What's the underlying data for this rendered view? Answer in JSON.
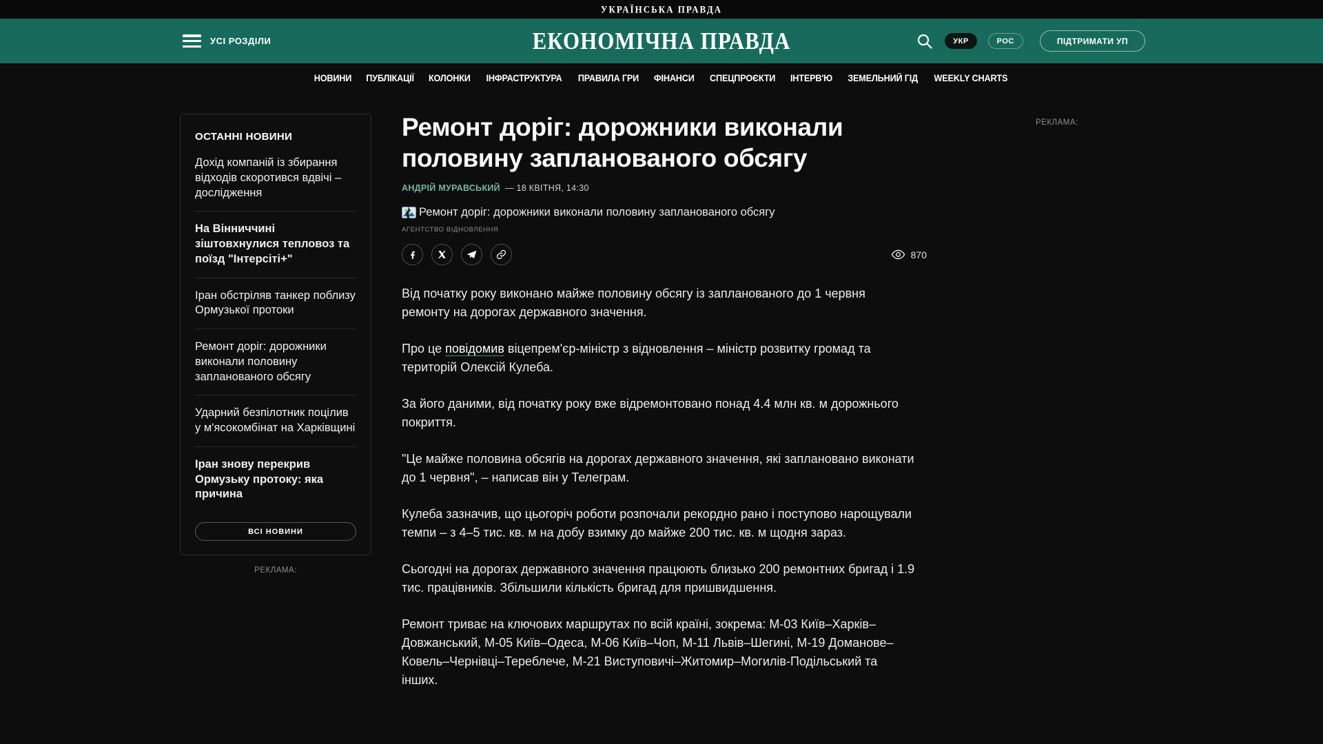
{
  "top_bar": {
    "logo": "УКРАЇНСЬКА ПРАВДА"
  },
  "header": {
    "menu_label": "УСІ РОЗДІЛИ",
    "logo": "ЕКОНОМІЧНА ПРАВДА",
    "lang_active": "УКР",
    "lang_inactive": "РОС",
    "support_button": "ПІДТРИМАТИ УП",
    "accent_color": "#186b5c"
  },
  "nav": {
    "items": [
      "НОВИНИ",
      "ПУБЛІКАЦІЇ",
      "КОЛОНКИ",
      "ІНФРАСТРУКТУРА",
      "ПРАВИЛА ГРИ",
      "ФІНАНСИ",
      "СПЕЦПРОЄКТИ",
      "ІНТЕРВ'Ю",
      "ЗЕМЕЛЬНИЙ ГІД",
      "WEEKLY CHARTS"
    ]
  },
  "sidebar": {
    "title": "ОСТАННІ НОВИНИ",
    "items": [
      {
        "text": "Дохід компаній із збирання відходів скоротився вдвічі – дослідження",
        "bold": false
      },
      {
        "text": "На Вінниччині зіштовхнулися тепловоз та поїзд \"Інтерсіті+\"",
        "bold": true
      },
      {
        "text": "Іран обстріляв танкер поблизу Ормузької протоки",
        "bold": false
      },
      {
        "text": "Ремонт доріг: дорожники виконали половину запланованого обсягу",
        "bold": false
      },
      {
        "text": "Ударний безпілотник поцілив у м'ясокомбінат на Харківщині",
        "bold": false
      },
      {
        "text": "Іран знову перекрив Ормузьку протоку: яка причина",
        "bold": true
      }
    ],
    "all_news_button": "ВСІ НОВИНИ",
    "ad_label": "РЕКЛАМА:"
  },
  "right_column": {
    "ad_label": "РЕКЛАМА:"
  },
  "article": {
    "title": "Ремонт доріг: дорожники виконали половину запланованого обсягу",
    "author": "АНДРІЙ МУРАВСЬКИЙ",
    "date": "— 18 КВІТНЯ, 14:30",
    "image_alt": "Ремонт доріг: дорожники виконали половину запланованого обсягу",
    "image_caption": "АГЕНТСТВО ВІДНОВЛЕННЯ",
    "views": "870",
    "share_icons": [
      "facebook-icon",
      "x-icon",
      "telegram-icon",
      "link-icon"
    ],
    "author_color": "#74b89c",
    "link_underline_color": "#3f9474",
    "paragraphs": [
      {
        "segments": [
          {
            "text": "Від початку року виконано майже половину обсягу із запланованого до 1 червня ремонту на дорогах державного значення."
          }
        ]
      },
      {
        "segments": [
          {
            "text": "Про це "
          },
          {
            "text": "повідомив",
            "link": true
          },
          {
            "text": " віцепрем'єр-міністр з відновлення – міністр розвитку громад та територій Олексій Кулеба."
          }
        ]
      },
      {
        "segments": [
          {
            "text": "За його даними, від початку року вже відремонтовано понад 4.4 млн кв. м дорожнього покриття."
          }
        ]
      },
      {
        "segments": [
          {
            "text": "\"Це майже половина обсягів на дорогах державного значення, які заплановано виконати до 1 червня\", – написав він у Телеграм."
          }
        ]
      },
      {
        "segments": [
          {
            "text": "Кулеба зазначив, що цьогоріч роботи розпочали рекордно рано і поступово нарощували темпи – з 4–5 тис. кв. м на добу взимку до майже 200 тис. кв. м щодня зараз."
          }
        ]
      },
      {
        "segments": [
          {
            "text": "Сьогодні на дорогах державного значення працюють близько 200 ремонтних бригад і 1.9 тис. працівників. Збільшили кількість бригад для пришвидшення."
          }
        ]
      },
      {
        "segments": [
          {
            "text": "Ремонт триває на ключових маршрутах по всій країні, зокрема: М-03 Київ–Харків–Довжанський, М-05 Київ–Одеса, М-06 Київ–Чоп, М-11 Львів–Шегині, М-19 Доманове–Ковель–Чернівці–Тереблече, М-21 Виступовичі–Житомир–Могилів-Подільський та інших."
          }
        ]
      }
    ]
  }
}
